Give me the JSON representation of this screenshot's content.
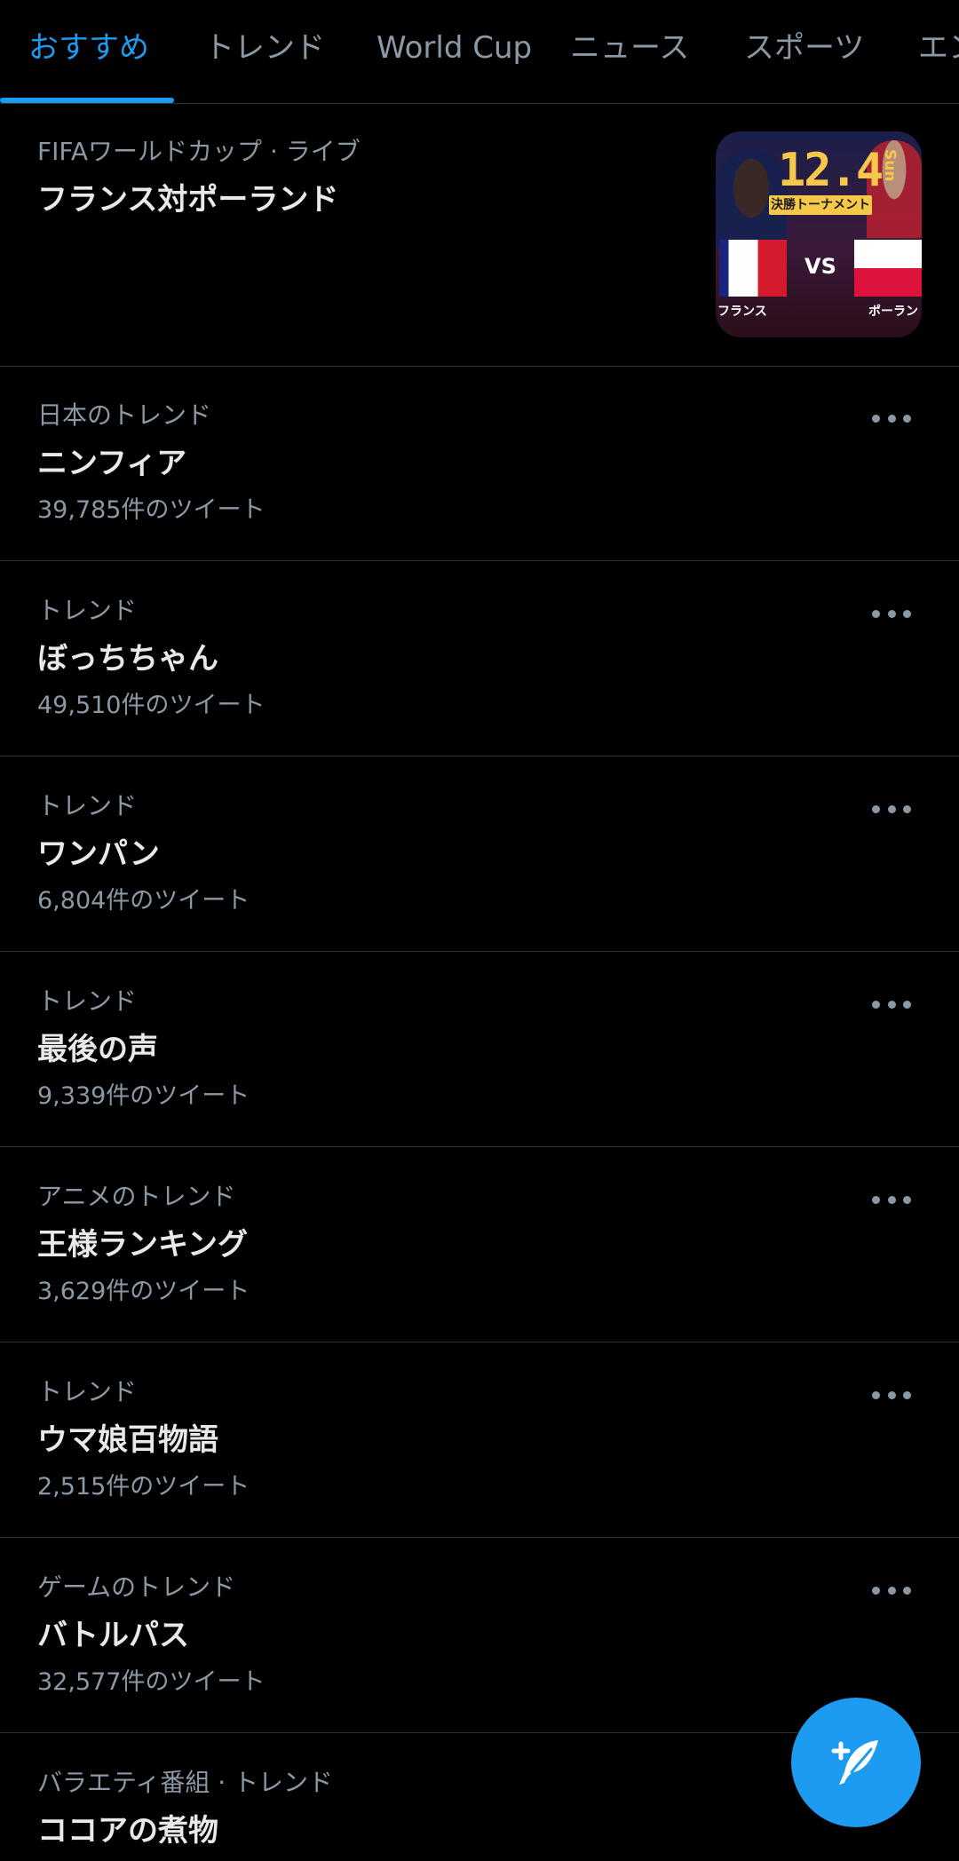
{
  "tabs": [
    {
      "label": "おすすめ"
    },
    {
      "label": "トレンド"
    },
    {
      "label": "World Cup"
    },
    {
      "label": "ニュース"
    },
    {
      "label": "スポーツ"
    },
    {
      "label": "エン"
    }
  ],
  "featured": {
    "category": "FIFAワールドカップ · ライブ",
    "title": "フランス対ポーランド",
    "thumbnail": {
      "date": "12.4",
      "day": "Sun",
      "badge": "決勝トーナメント",
      "vs": "VS",
      "team_left": "フランス",
      "team_right": "ポーラン"
    }
  },
  "trends": [
    {
      "category": "日本のトレンド",
      "title": "ニンフィア",
      "count": "39,785件のツイート"
    },
    {
      "category": "トレンド",
      "title": "ぼっちちゃん",
      "count": "49,510件のツイート"
    },
    {
      "category": "トレンド",
      "title": "ワンパン",
      "count": "6,804件のツイート"
    },
    {
      "category": "トレンド",
      "title": "最後の声",
      "count": "9,339件のツイート"
    },
    {
      "category": "アニメのトレンド",
      "title": "王様ランキング",
      "count": "3,629件のツイート"
    },
    {
      "category": "トレンド",
      "title": "ウマ娘百物語",
      "count": "2,515件のツイート"
    },
    {
      "category": "ゲームのトレンド",
      "title": "バトルパス",
      "count": "32,577件のツイート"
    },
    {
      "category": "バラエティ番組 · トレンド",
      "title": "ココアの煮物",
      "count": ""
    }
  ],
  "icons": {
    "more": "more-dots-icon",
    "compose": "compose-feather-icon"
  },
  "colors": {
    "accent": "#1d9bf0",
    "background": "#000000",
    "secondary_text": "#8b98a5"
  }
}
